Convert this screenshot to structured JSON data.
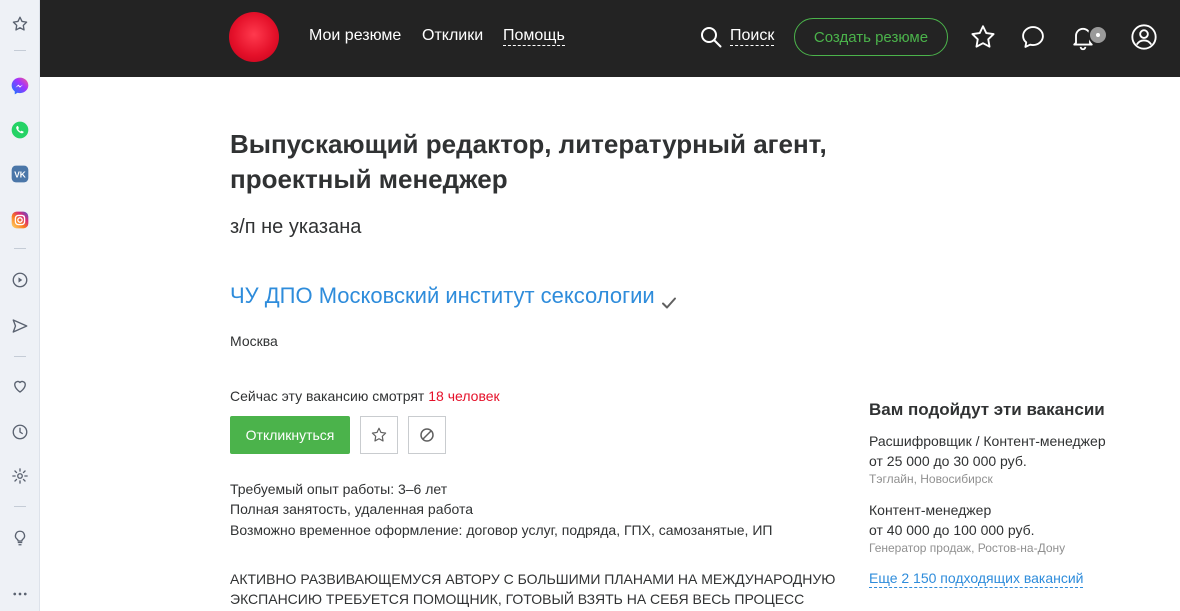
{
  "nav": {
    "my_resumes": "Мои резюме",
    "responses": "Отклики",
    "help": "Помощь",
    "search": "Поиск",
    "create_resume": "Создать резюме"
  },
  "vacancy": {
    "title": "Выпускающий редактор, литературный агент, проектный менеджер",
    "salary": "з/п не указана",
    "company": "ЧУ ДПО Московский институт сексологии",
    "city": "Москва",
    "watching_prefix": "Сейчас эту вакансию смотрят ",
    "watching_count": "18 человек",
    "apply_label": "Откликнуться",
    "conditions": [
      "Требуемый опыт работы: 3–6 лет",
      "Полная занятость, удаленная работа",
      "Возможно временное оформление: договор услуг, подряда, ГПХ, самозанятые, ИП"
    ],
    "description": "АКТИВНО РАЗВИВАЮЩЕМУСЯ АВТОРУ С БОЛЬШИМИ ПЛАНАМИ НА МЕЖДУНАРОДНУЮ ЭКСПАНСИЮ ТРЕБУЕТСЯ ПОМОЩНИК, ГОТОВЫЙ ВЗЯТЬ НА СЕБЯ ВЕСЬ ПРОЦЕСС"
  },
  "sidebar": {
    "title": "Вам подойдут эти вакансии",
    "vacancies": [
      {
        "name": "Расшифровщик / Контент-менеджер",
        "salary": "от 25 000 до 30 000 руб.",
        "meta": "Тэглайн, Новосибирск"
      },
      {
        "name": "Контент-менеджер",
        "salary": "от 40 000 до 100 000 руб.",
        "meta": "Генератор продаж, Ростов-на-Дону"
      }
    ],
    "more_link": "Еще 2 150 подходящих вакансий"
  },
  "colors": {
    "topbar": "#232323",
    "brand_red": "#e5112a",
    "accent_green": "#4bb34b",
    "link_blue": "#2e8cdb"
  }
}
